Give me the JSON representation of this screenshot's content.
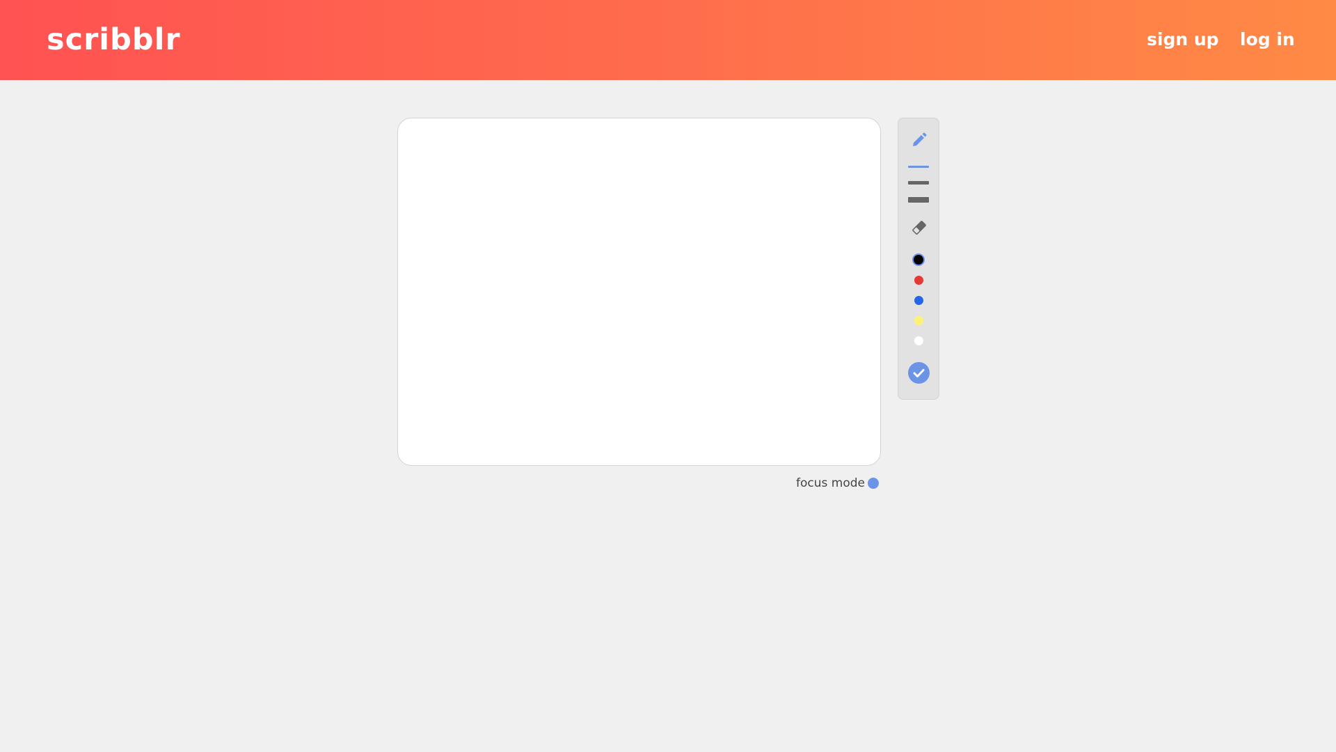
{
  "header": {
    "logo": "scribblr",
    "signup_label": "sign up",
    "login_label": "log in",
    "gradient_start": "#ff5252",
    "gradient_end": "#ff8a45"
  },
  "canvas": {
    "background": "#ffffff"
  },
  "focus_mode": {
    "label": "focus mode",
    "toggle_color": "#6b93e6"
  },
  "toolbar": {
    "tools": [
      "pencil-icon",
      "eraser-icon"
    ],
    "active_tool": "pencil",
    "brush_sizes": [
      "thin",
      "medium",
      "thick"
    ],
    "selected_size": "thin",
    "colors": [
      "#000000",
      "#e53935",
      "#2566e8",
      "#fff176",
      "#ffffff"
    ],
    "selected_color": "#000000",
    "accent_color": "#6b93e6",
    "confirm_icon": "check-icon"
  }
}
